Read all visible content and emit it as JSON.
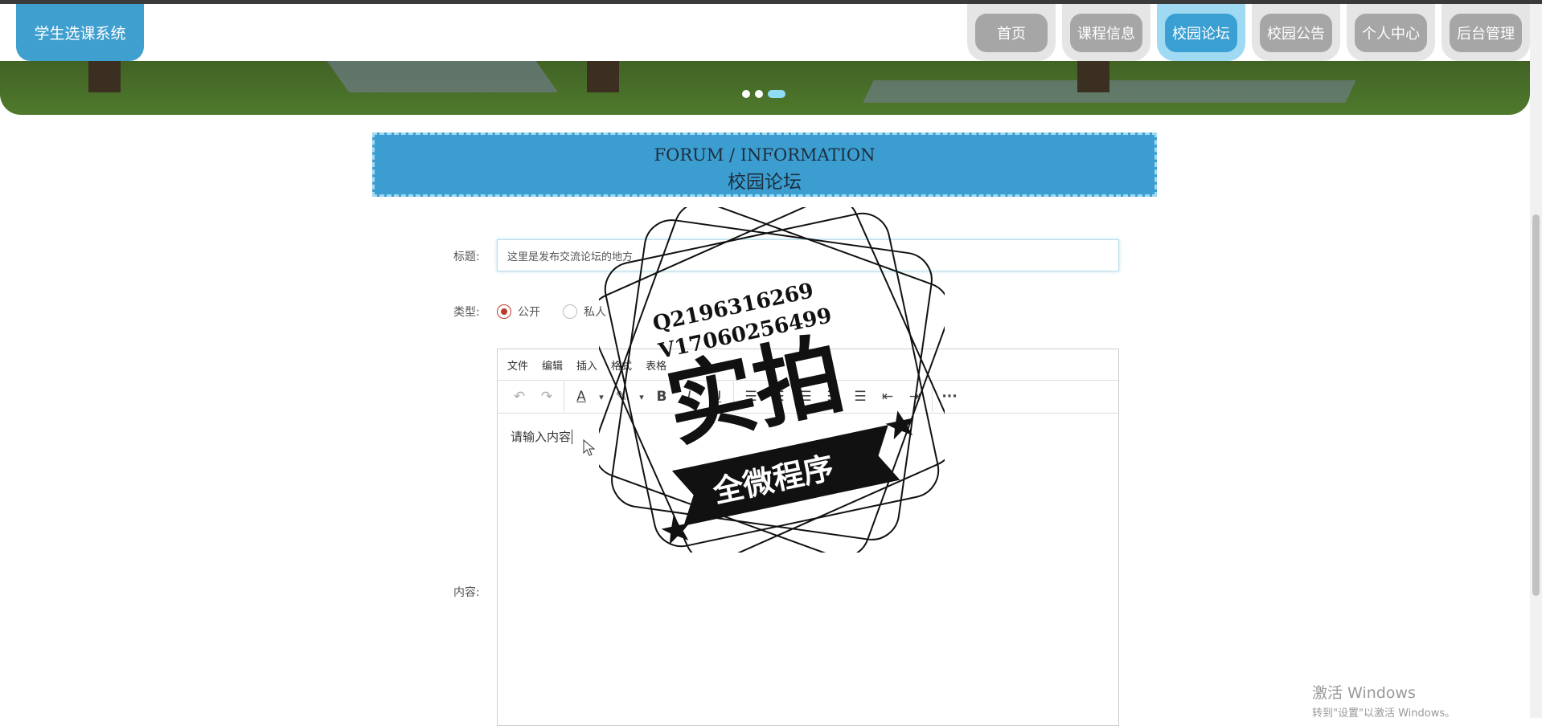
{
  "header": {
    "brand": "学生选课系统",
    "nav": [
      {
        "label": "首页",
        "active": false
      },
      {
        "label": "课程信息",
        "active": false
      },
      {
        "label": "校园论坛",
        "active": true
      },
      {
        "label": "校园公告",
        "active": false
      },
      {
        "label": "个人中心",
        "active": false
      },
      {
        "label": "后台管理",
        "active": false
      }
    ],
    "carousel": {
      "slide_count": 3,
      "current_slide": 3
    }
  },
  "section": {
    "title_en": "FORUM / INFORMATION",
    "title_zh": "校园论坛"
  },
  "form": {
    "title_label": "标题:",
    "title_value": "这里是发布交流论坛的地方",
    "type_label": "类型:",
    "type_options": [
      {
        "label": "公开",
        "checked": true
      },
      {
        "label": "私人",
        "checked": false
      }
    ],
    "content_label": "内容:",
    "editor": {
      "menus": [
        "文件",
        "编辑",
        "插入",
        "格式",
        "表格"
      ],
      "toolbar_icons": [
        "undo-icon",
        "redo-icon",
        "text-color-icon",
        "highlight-icon",
        "bold-icon",
        "italic-icon",
        "underline-icon",
        "list-icon",
        "align-left-icon",
        "align-center-icon",
        "align-right-icon",
        "align-justify-icon",
        "outdent-icon",
        "indent-icon",
        "more-icon"
      ],
      "body_text": "请输入内容"
    }
  },
  "stamp": {
    "line1": "Q2196316269",
    "line2": "V17060256499",
    "big": "实拍",
    "ribbon": "全微程序"
  },
  "windows_watermark": {
    "line1": "激活 Windows",
    "line2": "转到\"设置\"以激活 Windows。"
  },
  "colors": {
    "accent": "#3c9ed0",
    "nav_active_outer": "#9fd9f2",
    "nav_inactive": "#a6a6a6",
    "radio_checked": "#c0392b"
  }
}
